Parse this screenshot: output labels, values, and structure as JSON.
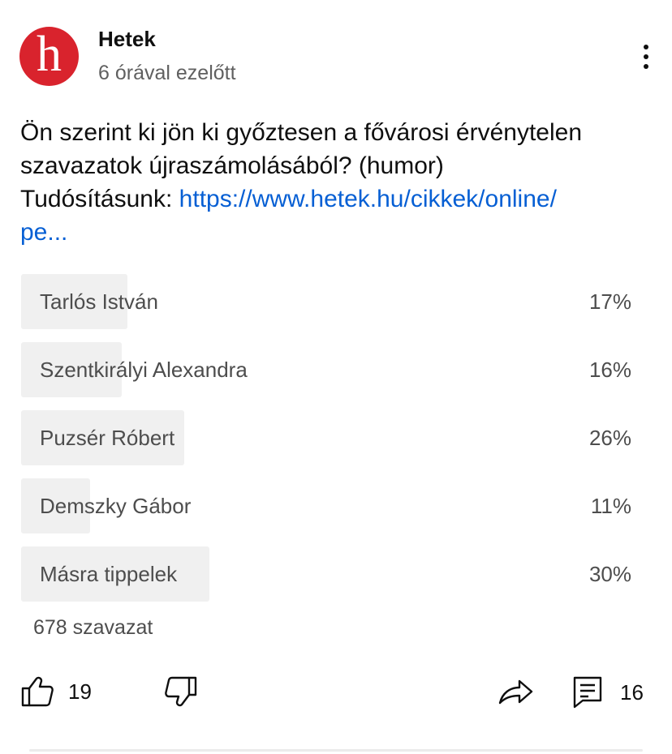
{
  "channel": {
    "name": "Hetek",
    "avatar_letter": "h",
    "time": "6 órával ezelőtt"
  },
  "post": {
    "text_line1": "Ön szerint ki jön ki győztesen a fővárosi érvénytelen",
    "text_line2": "szavazatok újraszámolásából? (humor)",
    "text_line3_prefix": "Tudósításunk: ",
    "link_line1": "https://www.hetek.hu/cikkek/online/",
    "link_line2": "pe..."
  },
  "poll": {
    "options": [
      {
        "label": "Tarlós István",
        "percent_text": "17%",
        "percent": 17
      },
      {
        "label": "Szentkirályi Alexandra",
        "percent_text": "16%",
        "percent": 16
      },
      {
        "label": "Puzsér Róbert",
        "percent_text": "26%",
        "percent": 26
      },
      {
        "label": "Demszky Gábor",
        "percent_text": "11%",
        "percent": 11
      },
      {
        "label": "Másra tippelek",
        "percent_text": "30%",
        "percent": 30
      }
    ],
    "votes": "678 szavazat"
  },
  "actions": {
    "likes": "19",
    "comments": "16",
    "like_icon": "thumb-up-icon",
    "dislike_icon": "thumb-down-icon",
    "share_icon": "share-icon",
    "comment_icon": "comment-icon"
  },
  "colors": {
    "avatar_bg": "#d9232d",
    "link": "#065fd4",
    "poll_fill": "#f0f0f0"
  }
}
